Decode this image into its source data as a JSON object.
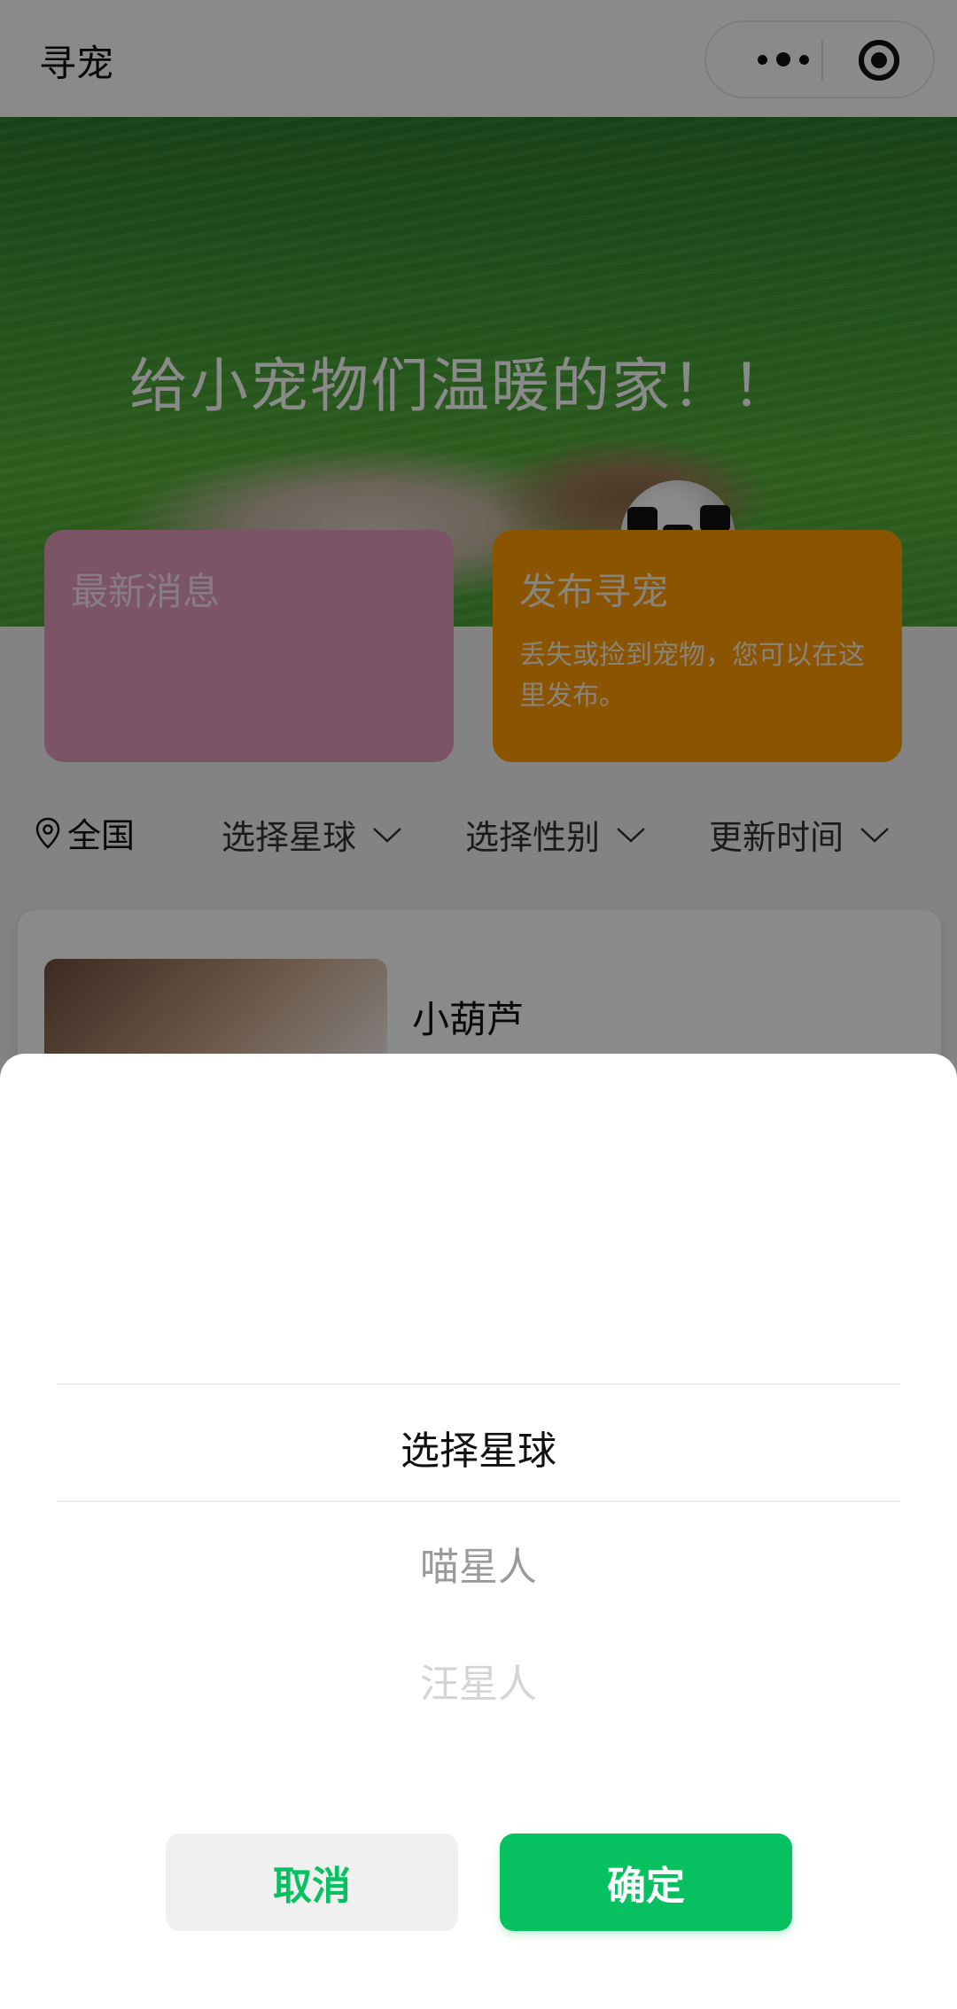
{
  "nav": {
    "title": "寻宠"
  },
  "hero": {
    "slogan": "给小宠物们温暖的家！！"
  },
  "cards": {
    "news": {
      "title": "最新消息"
    },
    "publish": {
      "title": "发布寻宠",
      "desc": "丢失或捡到宠物，您可以在这里发布。"
    }
  },
  "filters": {
    "location": "全国",
    "planet": "选择星球",
    "gender": "选择性别",
    "time": "更新时间"
  },
  "list": [
    {
      "name": "小葫芦"
    }
  ],
  "picker": {
    "options": [
      "选择星球",
      "喵星人",
      "汪星人"
    ],
    "selected": "选择星球",
    "cancel_label": "取消",
    "confirm_label": "确定",
    "accent": "#07c160"
  }
}
